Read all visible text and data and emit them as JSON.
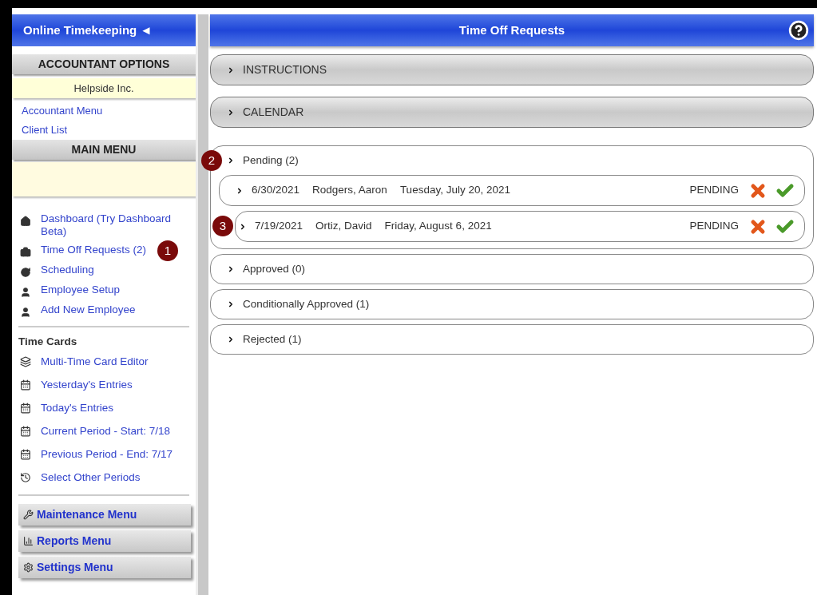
{
  "sidebar": {
    "title": "Online Timekeeping ◄",
    "accountant_options": {
      "heading": "ACCOUNTANT OPTIONS",
      "client": "Helpside Inc.",
      "links": [
        "Accountant Menu",
        "Client List"
      ]
    },
    "main_menu": {
      "heading": "MAIN MENU",
      "items": [
        {
          "label": "Dashboard (Try Dashboard Beta)"
        },
        {
          "label": "Time Off Requests (2)",
          "callout": "1"
        },
        {
          "label": "Scheduling"
        },
        {
          "label": "Employee Setup"
        },
        {
          "label": "Add New Employee"
        }
      ]
    },
    "time_cards": {
      "heading": "Time Cards",
      "items": [
        "Multi-Time Card Editor",
        "Yesterday's Entries",
        "Today's Entries",
        "Current Period - Start: 7/18",
        "Previous Period - End: 7/17",
        "Select Other Periods"
      ]
    },
    "menu_buttons": [
      "Maintenance Menu",
      "Reports Menu",
      "Settings Menu"
    ]
  },
  "main": {
    "title": "Time Off Requests",
    "sections": [
      {
        "label": "INSTRUCTIONS"
      },
      {
        "label": "CALENDAR"
      }
    ],
    "groups": [
      {
        "label": "Pending (2)",
        "callout": "2",
        "requests": [
          {
            "date": "6/30/2021",
            "name": "Rodgers, Aaron",
            "day": "Tuesday, July 20, 2021",
            "status": "PENDING"
          },
          {
            "date": "7/19/2021",
            "name": "Ortiz, David",
            "day": "Friday, August 6, 2021",
            "status": "PENDING",
            "callout": "3"
          }
        ]
      },
      {
        "label": "Approved (0)"
      },
      {
        "label": "Conditionally Approved (1)"
      },
      {
        "label": "Rejected (1)"
      }
    ]
  }
}
